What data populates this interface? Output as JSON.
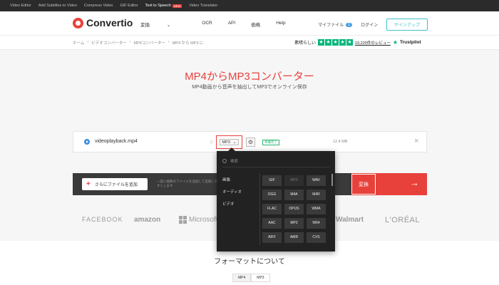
{
  "topbar": {
    "links": [
      "Video Editor",
      "Add Subtitles to Video",
      "Compress Video",
      "GIF Editor",
      "Text to Speech",
      "Video Translator"
    ],
    "new_badge": "NEW"
  },
  "header": {
    "logo_text": "Convertio",
    "nav": [
      "変換",
      "OCR",
      "API",
      "価格",
      "Help"
    ],
    "my_files": "マイファイル",
    "my_files_count": "1",
    "login": "ログイン",
    "signup": "サインアップ"
  },
  "breadcrumb": [
    "ホーム",
    "›",
    "ビデオコンバーター",
    "›",
    "MP4コンバーター",
    "›",
    "MP4 から MP3 に"
  ],
  "rating": {
    "label": "素晴らしい",
    "reviews": "10,220件のレビュー",
    "brand": "Trustpilot"
  },
  "hero": {
    "title": "MP4からMP3コンバーター",
    "subtitle": "MP4動画から音声を抽出してMP3でオンライン保存"
  },
  "file": {
    "name": "videoplayback.mp4",
    "to_label": "に",
    "format": "MP3",
    "status": "準備完了",
    "size": "12.4 MB"
  },
  "actions": {
    "add_files": "さらにファイルを追加",
    "drop_hint": "一度に複数のファイルを追加して変換しやすくします",
    "convert": "変換"
  },
  "brands": [
    "FACEBOOK",
    "amazon",
    "Microsoft",
    "Walmart",
    "L'ORÉAL"
  ],
  "dropdown": {
    "search_placeholder": "検索",
    "categories": [
      "画像",
      "オーディオ",
      "ビデオ"
    ],
    "formats": [
      "GIF",
      "MP3",
      "WAV",
      "OGG",
      "M4A",
      "M4R",
      "FLAC",
      "OPUS",
      "WMA",
      "AAC",
      "MP2",
      "W64",
      "AIFF",
      "AMR",
      "CVS"
    ],
    "disabled_format": "MP3"
  },
  "formats_section": {
    "heading": "フォーマットについて",
    "tabs": [
      "MP4",
      "MP3"
    ]
  },
  "colors": {
    "accent": "#e8413b",
    "trustpilot": "#00b67a",
    "dark": "#2b2b2b"
  }
}
